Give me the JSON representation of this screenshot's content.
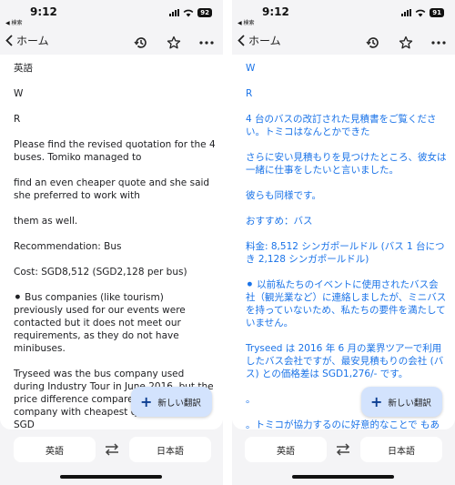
{
  "screens": [
    {
      "status": {
        "time": "9:12",
        "back_label": "◀ 検索",
        "battery": "92"
      },
      "topbar": {
        "back_label": "ホーム"
      },
      "paragraphs": [
        "英語",
        "W",
        "R",
        "Please find the revised quotation for the 4 buses. Tomiko managed to",
        "find an even cheaper quote and she said she preferred to work with",
        "them as well.",
        "Recommendation: Bus",
        "Cost: SGD8,512 (SGD2,128 per bus)",
        "⚫ Bus companies (like tourism) previously used for our events were contacted but it does not meet our requirements, as they do not have minibuses.",
        "Tryseed was the bus company used during Industry Tour in June 2016, but the price difference compared to the company with cheapest quote (Bus) is SGD",
        "."
      ],
      "fab_label": "新しい翻訳",
      "lang_source": "英語",
      "lang_target": "日本語"
    },
    {
      "status": {
        "time": "9:12",
        "back_label": "◀ 検索",
        "battery": "91"
      },
      "topbar": {
        "back_label": "ホーム"
      },
      "paragraphs": [
        "W",
        "R",
        "4 台のバスの改訂された見積書をご覧ください。トミコはなんとかできた",
        "さらに安い見積もりを見つけたところ、彼女は一緒に仕事をしたいと言いました。",
        "彼らも同様です。",
        "おすすめ：バス",
        "料金: 8,512 シンガポールドル (バス 1 台につき 2,128 シンガポールドル)",
        "⚫ 以前私たちのイベントに使用されたバス会社（観光業など）に連絡しましたが、ミニバスを持っていないため、私たちの要件を満たしていません。",
        "Tryseed は 2016 年 6 月の業界ツアーで利用したバス会社ですが、最安見積もりの会社 (バス) との価格差は SGD1,276/- です。",
        "。",
        "。トミコが協力するのに好意的なことで もあります。 。価格を重視する場合は、バス"
      ],
      "fab_label": "新しい翻訳",
      "lang_source": "英語",
      "lang_target": "日本語"
    }
  ]
}
